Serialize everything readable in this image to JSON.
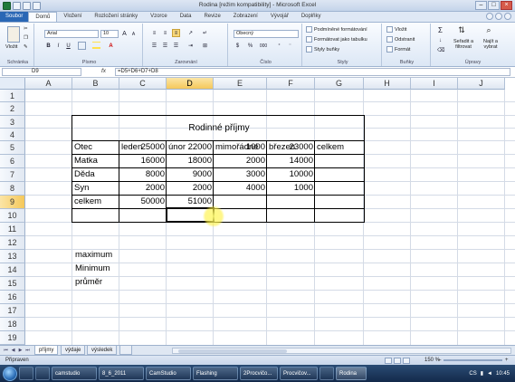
{
  "title": {
    "window": "Rodina  [režim kompatibility]  -  Microsoft Excel",
    "controls": [
      "–",
      "□",
      "×"
    ]
  },
  "tabs": [
    {
      "label": "Soubor"
    },
    {
      "label": "Domů"
    },
    {
      "label": "Vložení"
    },
    {
      "label": "Rozložení stránky"
    },
    {
      "label": "Vzorce"
    },
    {
      "label": "Data"
    },
    {
      "label": "Revize"
    },
    {
      "label": "Zobrazení"
    },
    {
      "label": "Vývojář"
    },
    {
      "label": "Doplňky"
    }
  ],
  "ribbon": {
    "clipboard": {
      "paste": "Vložit",
      "label": "Schránka"
    },
    "font": {
      "name": "Arial",
      "size": "10",
      "bold": "B",
      "italic": "I",
      "underline": "U",
      "grow": "A",
      "shrink": "A",
      "label": "Písmo"
    },
    "alignment": {
      "label": "Zarovnání"
    },
    "number": {
      "format": "Obecný",
      "percent": "%",
      "thousands": "000",
      "label": "Číslo"
    },
    "styles": {
      "conditional": "Podmíněné formátování",
      "table": "Formátovat jako tabulku",
      "cell": "Styly buňky",
      "label": "Styly"
    },
    "cells": {
      "insert": "Vložit",
      "delete": "Odstranit",
      "format": "Formát",
      "label": "Buňky"
    },
    "editing": {
      "sum": "Σ",
      "sort": "Seřadit a filtrovat",
      "find": "Najít a vybrat",
      "label": "Úpravy"
    }
  },
  "formula_bar": {
    "name_box": "D9",
    "fx": "fx",
    "formula": "=D5+D6+D7+D8"
  },
  "columns": [
    "A",
    "B",
    "C",
    "D",
    "E",
    "F",
    "G",
    "H",
    "I",
    "J"
  ],
  "rows": [
    "1",
    "2",
    "3",
    "4",
    "5",
    "6",
    "7",
    "8",
    "9",
    "10",
    "11",
    "12",
    "13",
    "14",
    "15",
    "16",
    "17",
    "18",
    "19"
  ],
  "active_cell": "D9",
  "sheet": {
    "title": "Rodinné příjmy",
    "headers": [
      "leden",
      "únor",
      "mimořádné",
      "březen",
      "celkem"
    ],
    "rows": [
      {
        "name": "Otec",
        "values": [
          "25000",
          "22000",
          "1000",
          "23000"
        ]
      },
      {
        "name": "Matka",
        "values": [
          "16000",
          "18000",
          "2000",
          "14000"
        ]
      },
      {
        "name": "Děda",
        "values": [
          "8000",
          "9000",
          "3000",
          "10000"
        ]
      },
      {
        "name": "Syn",
        "values": [
          "2000",
          "2000",
          "4000",
          "1000"
        ]
      },
      {
        "name": "celkem",
        "values": [
          "50000",
          "51000",
          "",
          ""
        ]
      }
    ],
    "stats": [
      "maximum",
      "Minimum",
      "průměr"
    ]
  },
  "sheet_tabs": [
    "příjmy",
    "výdaje",
    "výsledek"
  ],
  "status": {
    "ready": "Připraven",
    "zoom": "150 %",
    "zoom_minus": "–",
    "zoom_plus": "+"
  },
  "taskbar": {
    "items": [
      "camstudio",
      "8_6_2011",
      "CamStudio",
      "Flashing",
      "2Procvičo...",
      "Procvičov...",
      "",
      "Rodina"
    ],
    "lang": "CS",
    "clock": "10:45"
  },
  "colors": {
    "accent": "#2a67b5",
    "selection": "#f5c85a",
    "grid": "#d4dbe6"
  }
}
